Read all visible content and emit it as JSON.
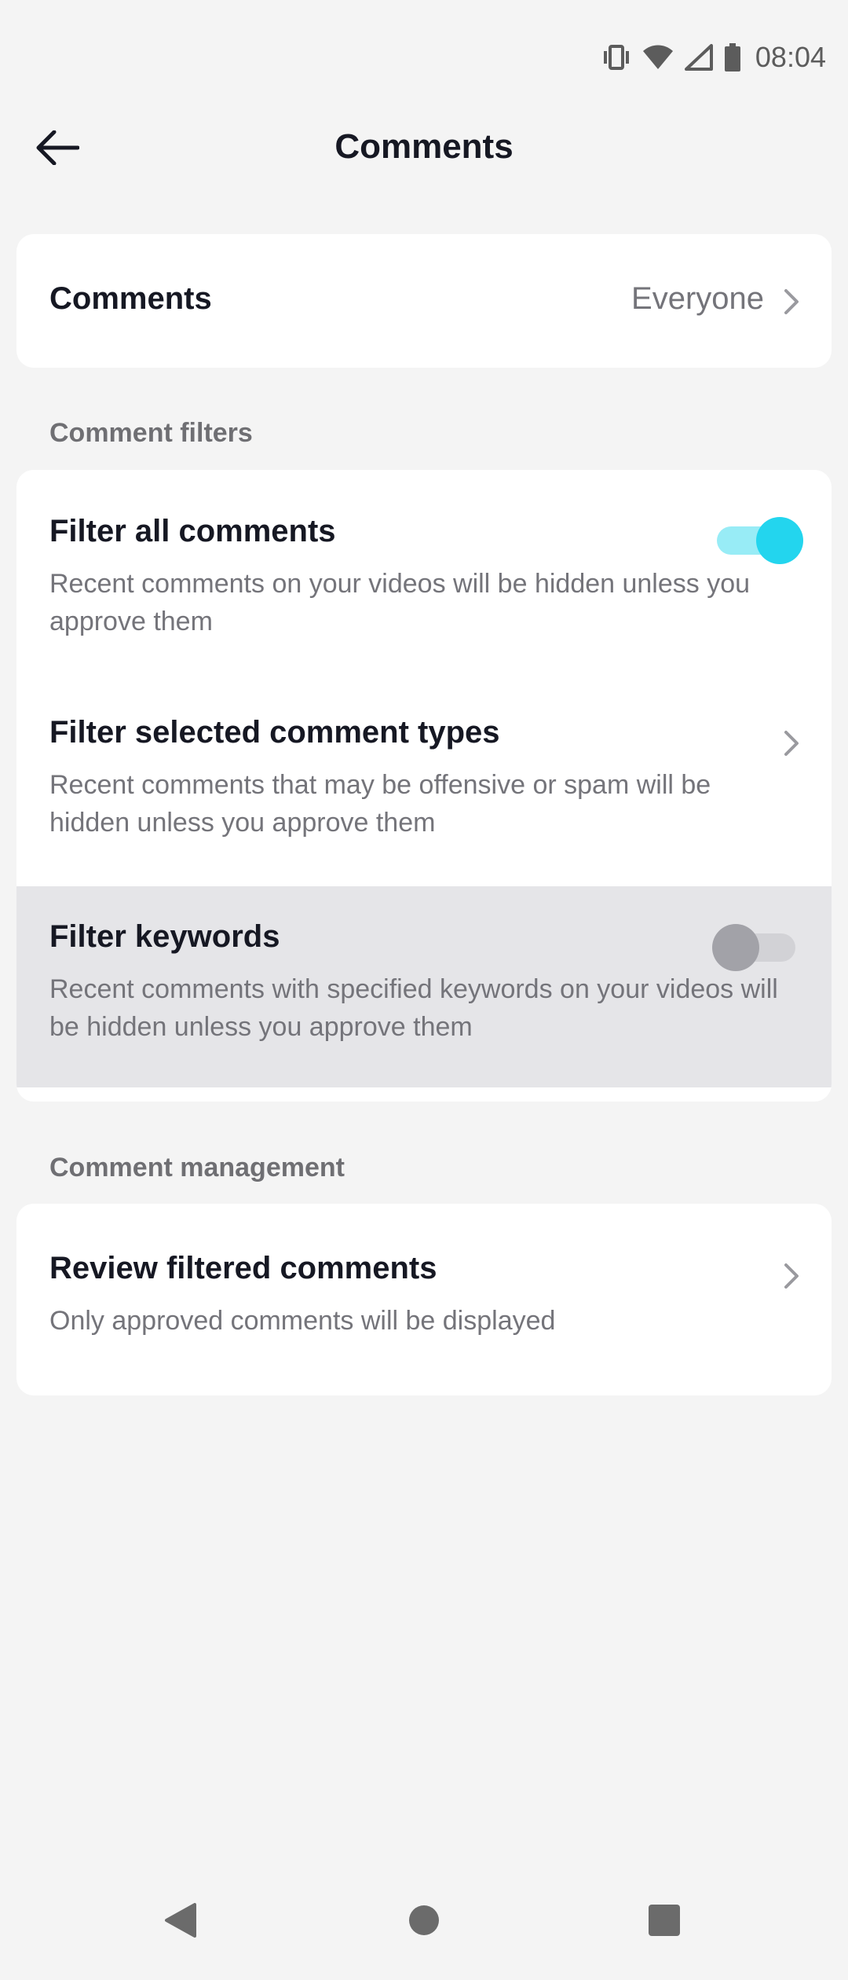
{
  "status_bar": {
    "time": "08:04",
    "icons": [
      "vibrate-icon",
      "wifi-icon",
      "signal-icon",
      "battery-icon"
    ]
  },
  "header": {
    "title": "Comments",
    "back_icon": "arrow-left-icon"
  },
  "comments_setting": {
    "label": "Comments",
    "value": "Everyone"
  },
  "comment_filters": {
    "section_label": "Comment filters",
    "items": [
      {
        "title": "Filter all comments",
        "description": "Recent comments on your videos will be hidden unless you approve them",
        "control": "toggle",
        "enabled": true
      },
      {
        "title": "Filter selected comment types",
        "description": "Recent comments that may be offensive or spam will be hidden unless you approve them",
        "control": "chevron"
      },
      {
        "title": "Filter keywords",
        "description": "Recent comments with specified keywords on your videos will be hidden unless you approve them",
        "control": "toggle",
        "enabled": false
      }
    ]
  },
  "comment_management": {
    "section_label": "Comment management",
    "items": [
      {
        "title": "Review filtered comments",
        "description": "Only approved comments will be displayed"
      }
    ]
  },
  "colors": {
    "toggle_on_track": "#98ecf6",
    "toggle_on_knob": "#23d5ee",
    "toggle_off_track": "#d2d2d6",
    "toggle_off_knob": "#a2a2a8",
    "highlight_row": "#e5e5e8",
    "background": "#f4f4f4"
  },
  "nav_bar": {
    "buttons": [
      "back-triangle-icon",
      "home-circle-icon",
      "recents-square-icon"
    ]
  }
}
